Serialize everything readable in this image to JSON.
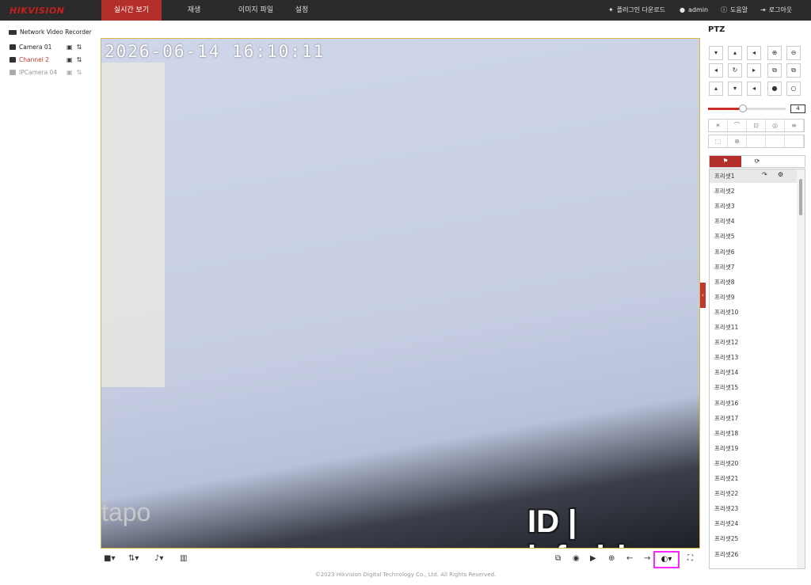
{
  "topbar": {
    "logo": "HIKVISION",
    "nav": [
      "실시간 보기",
      "재생",
      "이미지 파일",
      "설정"
    ],
    "plugin_download": "플러그인 다운로드",
    "user": "admin",
    "help": "도움말",
    "logout": "로그아웃"
  },
  "tree": {
    "title": "Network Video Recorder",
    "cameras": [
      "Camera 01",
      "Channel 2",
      "IPCamera 04"
    ]
  },
  "video": {
    "timestamp": "2026-06-14 16:10:11",
    "overlay_brand": "tapo",
    "watermark": "ID | infodrive"
  },
  "ptz": {
    "title": "PTZ",
    "speed": "4",
    "speed_fraction": 0.45,
    "presets": [
      "프리셋1",
      "프리셋2",
      "프리셋3",
      "프리셋4",
      "프리셋5",
      "프리셋6",
      "프리셋7",
      "프리셋8",
      "프리셋9",
      "프리셋10",
      "프리셋11",
      "프리셋12",
      "프리셋13",
      "프리셋14",
      "프리셋15",
      "프리셋16",
      "프리셋17",
      "프리셋18",
      "프리셋19",
      "프리셋20",
      "프리셋21",
      "프리셋22",
      "프리셋23",
      "프리셋24",
      "프리셋25",
      "프리셋26"
    ]
  },
  "footer": "©2023 Hikvision Digital Technology Co., Ltd. All Rights Reserved.",
  "colors": {
    "accent": "#b52f2a",
    "highlight": "#ff26ff",
    "topbar": "#2b2b2b"
  }
}
